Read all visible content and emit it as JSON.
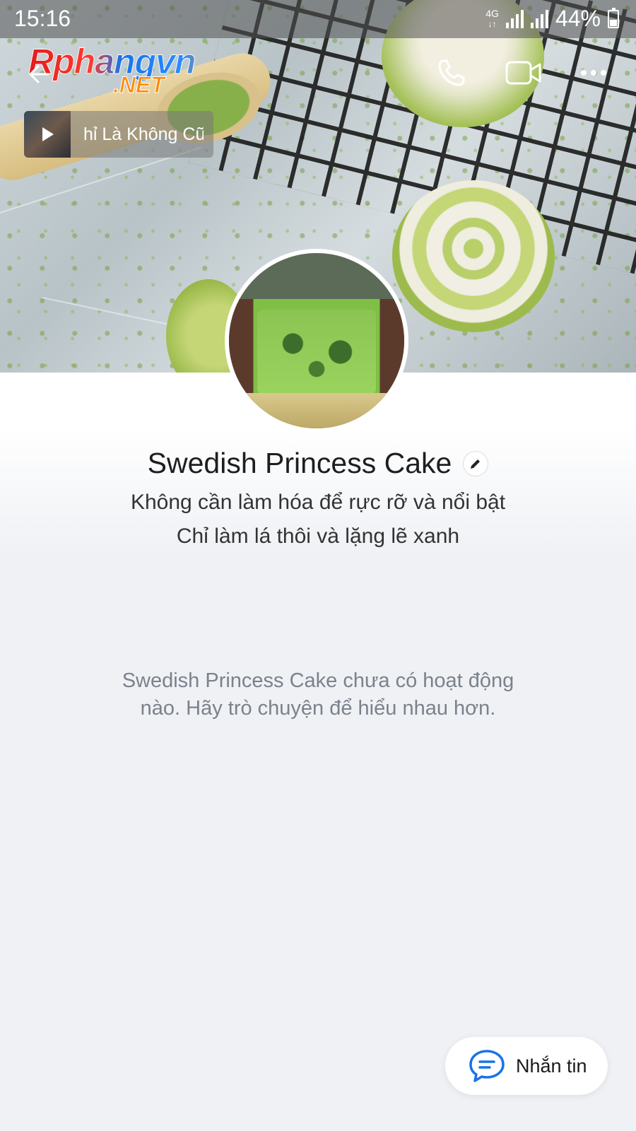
{
  "status_bar": {
    "time": "15:16",
    "network": "4G",
    "battery": "44%"
  },
  "watermark": {
    "main": "Rphangvn",
    "suffix": ".NET"
  },
  "music": {
    "title": "hỉ Là Không Cũ"
  },
  "profile": {
    "name": "Swedish Princess Cake",
    "bio_line1": "Không cần làm hóa để rực rỡ và nổi bật",
    "bio_line2": "Chỉ làm lá thôi và lặng lẽ xanh"
  },
  "feed": {
    "empty_message": "Swedish Princess Cake chưa có hoạt động nào. Hãy trò chuyện để hiểu nhau hơn."
  },
  "actions": {
    "message_label": "Nhắn tin"
  },
  "colors": {
    "accent": "#1a73e8",
    "background": "#eff1f5"
  },
  "icons": [
    "back-arrow-icon",
    "phone-icon",
    "video-call-icon",
    "more-icon",
    "play-icon",
    "edit-icon",
    "chat-icon"
  ]
}
